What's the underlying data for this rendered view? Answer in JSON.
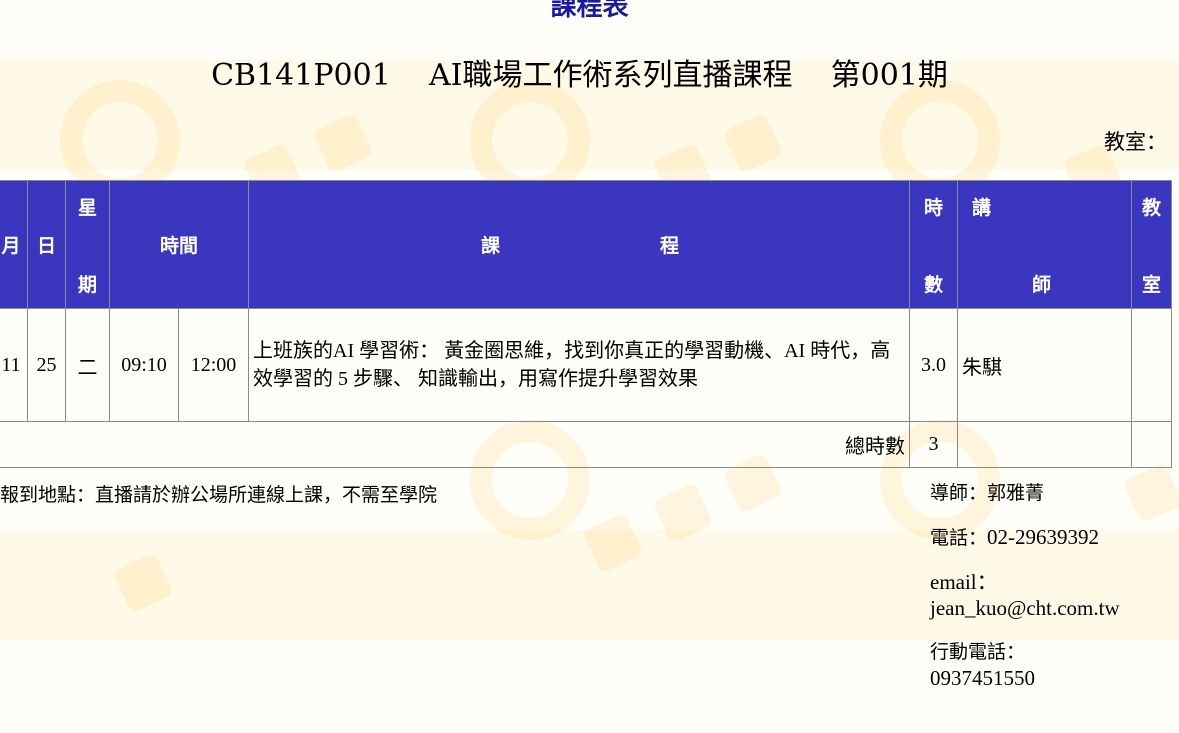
{
  "document": {
    "title": "課程表",
    "course_code": "CB141P001",
    "course_name": "AI職場工作術系列直播課程",
    "term": "第001期",
    "classroom_label": "教室："
  },
  "table": {
    "headers": {
      "month": "月",
      "day": "日",
      "weekday_top": "星",
      "weekday_bottom": "期",
      "time": "時間",
      "course_left": "課",
      "course_right": "程",
      "hours_top": "時",
      "hours_bottom": "數",
      "teacher_top": "講",
      "teacher_bottom": "師",
      "room_top": "教",
      "room_bottom": "室"
    },
    "rows": [
      {
        "month": "11",
        "day": "25",
        "weekday": "二",
        "start": "09:10",
        "end": "12:00",
        "course": "上班族的AI 學習術： 黃金圈思維，找到你真正的學習動機、AI 時代，高效學習的 5 步驟、 知識輸出，用寫作提升學習效果",
        "hours": "3.0",
        "teacher": "朱騏",
        "room": ""
      }
    ],
    "total_label": "總時數",
    "total_hours": "3"
  },
  "footer": {
    "report_location": "報到地點：直播請於辦公場所連線上課，不需至學院",
    "mentor": "導師：郭雅菁",
    "phone_label": "電話：",
    "phone": "02-29639392",
    "email_label": "email：",
    "email": "jean_kuo@cht.com.tw",
    "mobile_label": "行動電話：",
    "mobile": "0937451550"
  },
  "colors": {
    "title": "#1a1aa0",
    "header_bg": "#3b36c0",
    "watermark": "#ffd878"
  }
}
